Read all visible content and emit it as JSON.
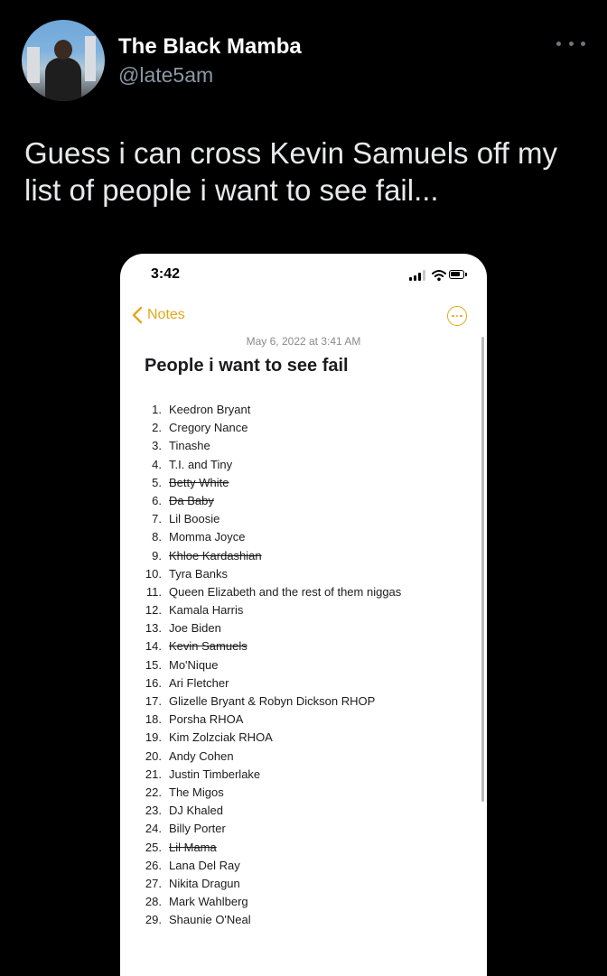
{
  "tweet": {
    "display_name": "The Black Mamba",
    "handle": "@late5am",
    "text": "Guess i can cross Kevin Samuels off my list of people i want to see fail...",
    "more_icon": "ellipsis-horizontal-icon"
  },
  "phone": {
    "status_time": "3:42",
    "nav_back_label": "Notes",
    "accent_color": "#e3a81a",
    "note_date": "May 6, 2022 at 3:41 AM",
    "note_title": "People i want to see fail",
    "items": [
      {
        "num": "1.",
        "text": "Keedron Bryant",
        "struck": false
      },
      {
        "num": "2.",
        "text": "Cregory Nance",
        "struck": false
      },
      {
        "num": "3.",
        "text": "Tinashe",
        "struck": false
      },
      {
        "num": "4.",
        "text": "T.I. and Tiny",
        "struck": false
      },
      {
        "num": "5.",
        "text": "Betty White",
        "struck": true
      },
      {
        "num": "6.",
        "text": "Da Baby",
        "struck": true
      },
      {
        "num": "7.",
        "text": "Lil Boosie",
        "struck": false
      },
      {
        "num": "8.",
        "text": "Momma Joyce",
        "struck": false
      },
      {
        "num": "9.",
        "text": "Khloe Kardashian",
        "struck": true
      },
      {
        "num": "10.",
        "text": "Tyra Banks",
        "struck": false
      },
      {
        "num": "11.",
        "text": "Queen Elizabeth and the rest of them niggas",
        "struck": false
      },
      {
        "num": "12.",
        "text": "Kamala Harris",
        "struck": false
      },
      {
        "num": "13.",
        "text": "Joe Biden",
        "struck": false
      },
      {
        "num": "14.",
        "text": "Kevin Samuels",
        "struck": true
      },
      {
        "num": "15.",
        "text": "Mo'Nique",
        "struck": false
      },
      {
        "num": "16.",
        "text": "Ari Fletcher",
        "struck": false
      },
      {
        "num": "17.",
        "text": "Glizelle Bryant & Robyn Dickson RHOP",
        "struck": false
      },
      {
        "num": "18.",
        "text": "Porsha RHOA",
        "struck": false
      },
      {
        "num": "19.",
        "text": "Kim Zolzciak RHOA",
        "struck": false
      },
      {
        "num": "20.",
        "text": "Andy Cohen",
        "struck": false
      },
      {
        "num": "21.",
        "text": "Justin Timberlake",
        "struck": false
      },
      {
        "num": "22.",
        "text": "The Migos",
        "struck": false
      },
      {
        "num": "23.",
        "text": "DJ Khaled",
        "struck": false
      },
      {
        "num": "24.",
        "text": "Billy Porter",
        "struck": false
      },
      {
        "num": "25.",
        "text": "Lil Mama",
        "struck": true
      },
      {
        "num": "26.",
        "text": "Lana Del Ray",
        "struck": false
      },
      {
        "num": "27.",
        "text": "Nikita Dragun",
        "struck": false
      },
      {
        "num": "28.",
        "text": "Mark Wahlberg",
        "struck": false
      },
      {
        "num": "29.",
        "text": "Shaunie O'Neal",
        "struck": false
      }
    ]
  }
}
